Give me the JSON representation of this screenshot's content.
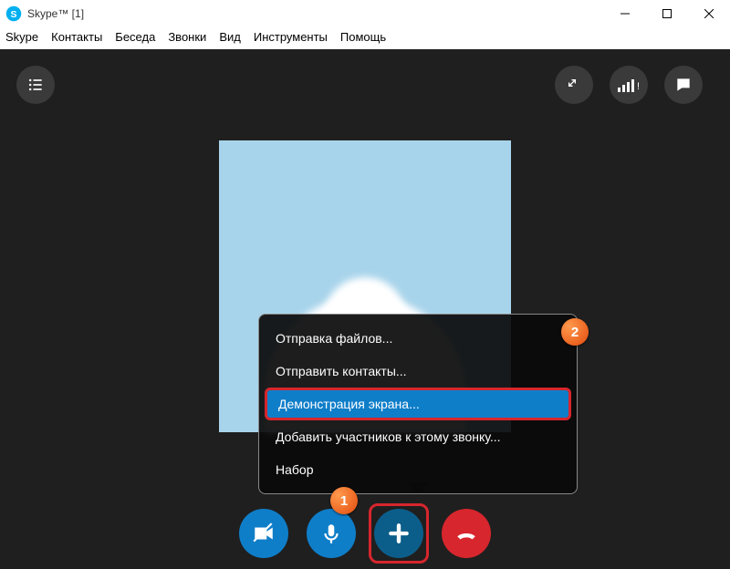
{
  "window": {
    "title": "Skype™ [1]"
  },
  "menu": {
    "items": [
      "Skype",
      "Контакты",
      "Беседа",
      "Звонки",
      "Вид",
      "Инструменты",
      "Помощь"
    ]
  },
  "popup": {
    "items": [
      {
        "label": "Отправка файлов...",
        "selected": false
      },
      {
        "label": "Отправить контакты...",
        "selected": false
      },
      {
        "label": "Демонстрация экрана...",
        "selected": true
      },
      {
        "label": "Добавить участников к этому звонку...",
        "selected": false
      },
      {
        "label": "Набор",
        "selected": false
      }
    ]
  },
  "markers": {
    "first": "1",
    "second": "2"
  },
  "colors": {
    "accent": "#0f7ec9",
    "hangup": "#d7262d",
    "bg": "#1f1f1f"
  }
}
